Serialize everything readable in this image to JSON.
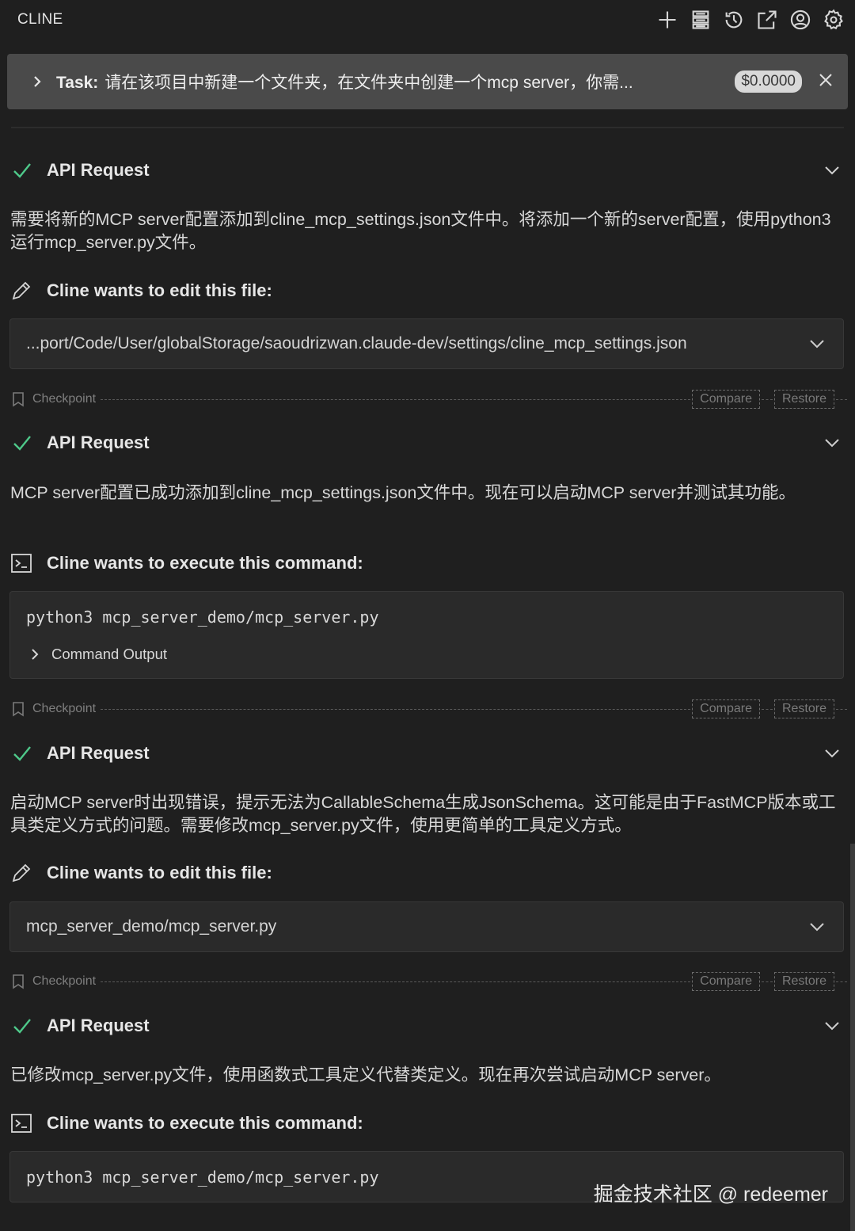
{
  "header": {
    "title": "CLINE"
  },
  "header_icons": [
    "plus-icon",
    "server-stack-icon",
    "history-icon",
    "popout-icon",
    "account-icon",
    "gear-icon"
  ],
  "task": {
    "prefix": "Task:",
    "text": "请在该项目中新建一个文件夹，在文件夹中创建一个mcp server，你需...",
    "cost": "$0.0000"
  },
  "messages": {
    "api_label": "API Request",
    "edit_label": "Cline wants to edit this file:",
    "exec_label": "Cline wants to execute this command:",
    "msg1": "需要将新的MCP server配置添加到cline_mcp_settings.json文件中。将添加一个新的server配置，使用python3运行mcp_server.py文件。",
    "file1": "...port/Code/User/globalStorage/saoudrizwan.claude-dev/settings/cline_mcp_settings.json",
    "msg2": "MCP server配置已成功添加到cline_mcp_settings.json文件中。现在可以启动MCP server并测试其功能。",
    "cmd1": "python3 mcp_server_demo/mcp_server.py",
    "output_label": "Command Output",
    "msg3": "启动MCP server时出现错误，提示无法为CallableSchema生成JsonSchema。这可能是由于FastMCP版本或工具类定义方式的问题。需要修改mcp_server.py文件，使用更简单的工具定义方式。",
    "file2": "mcp_server_demo/mcp_server.py",
    "msg4": "已修改mcp_server.py文件，使用函数式工具定义代替类定义。现在再次尝试启动MCP server。",
    "cmd2": "python3 mcp_server_demo/mcp_server.py"
  },
  "checkpoint": {
    "label": "Checkpoint",
    "compare": "Compare",
    "restore": "Restore"
  },
  "watermark": "掘金技术社区 @ redeemer",
  "colors": {
    "background": "#1f1f1f",
    "task_bar": "#4a4a4a",
    "check": "#4ec98a"
  }
}
